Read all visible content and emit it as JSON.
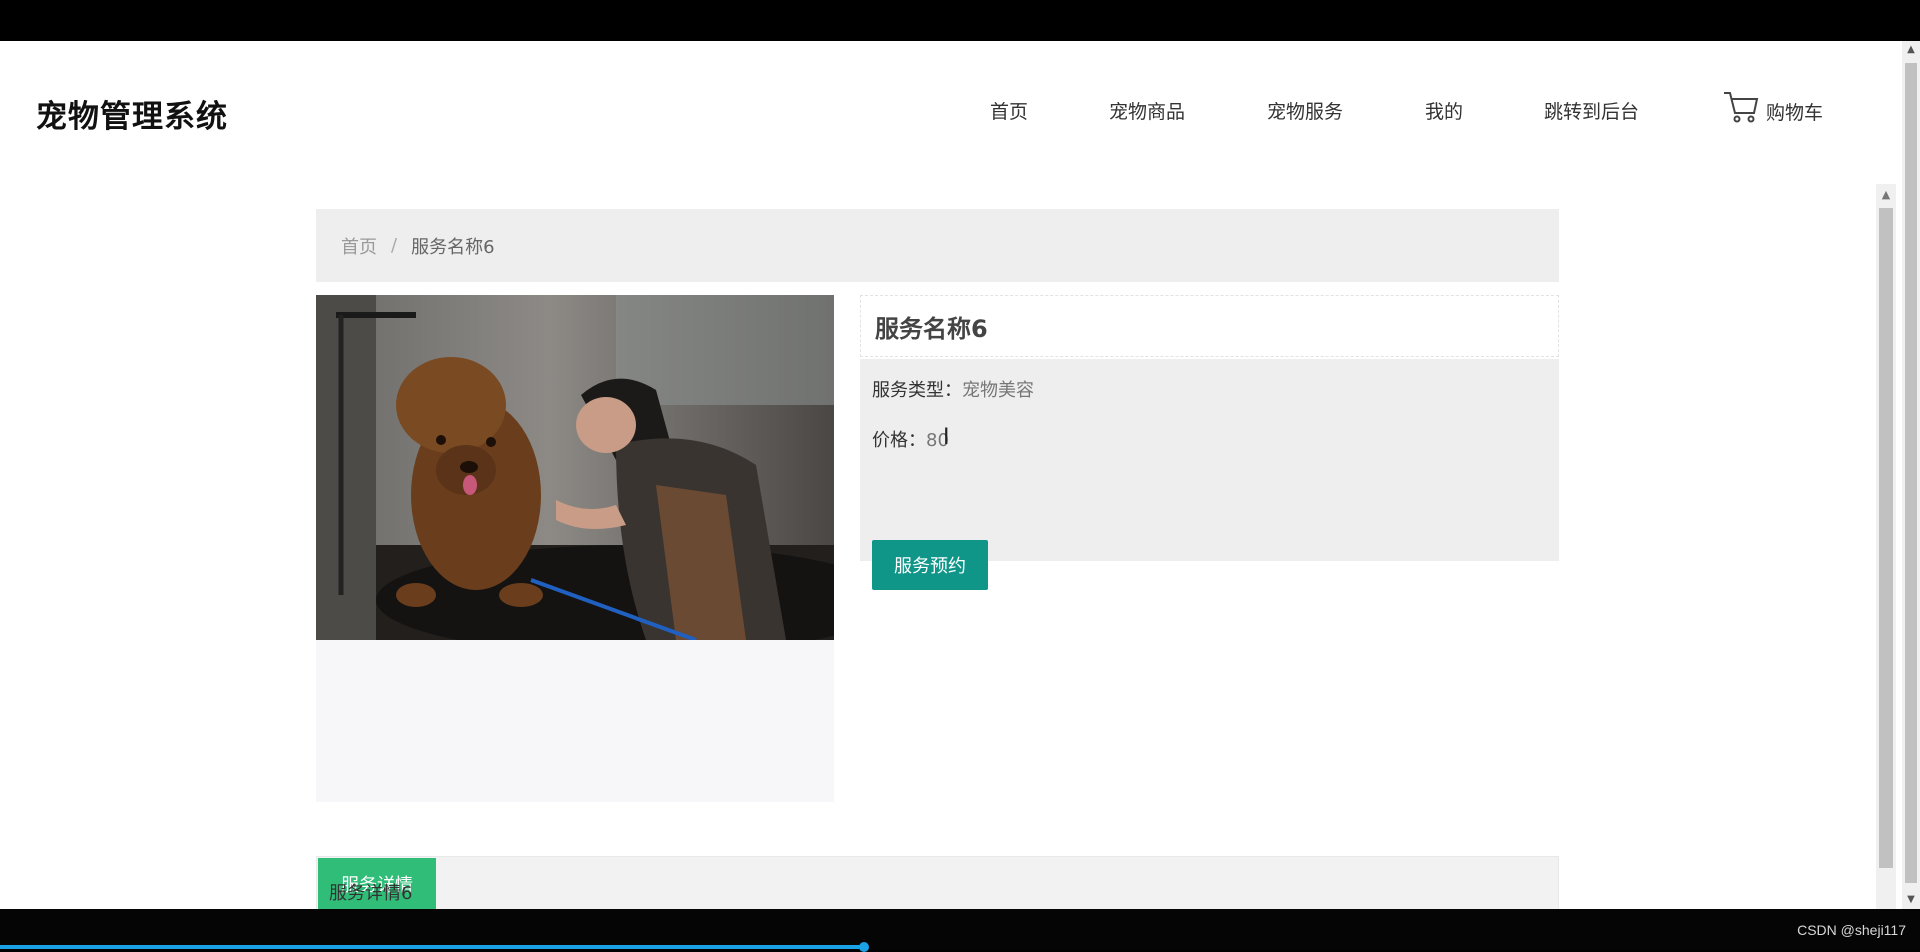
{
  "header": {
    "logo": "宠物管理系统",
    "nav": [
      "首页",
      "宠物商品",
      "宠物服务",
      "我的",
      "跳转到后台"
    ],
    "cart_label": "购物车"
  },
  "breadcrumb": {
    "home": "首页",
    "separator": "/",
    "current": "服务名称6"
  },
  "service": {
    "title": "服务名称6",
    "type_label": "服务类型：",
    "type_value": "宠物美容",
    "price_label": "价格：",
    "price_value": "80",
    "book_button": "服务预约"
  },
  "tabs": {
    "active": "服务详情",
    "content": "服务详情6"
  },
  "footer": {
    "watermark": "CSDN @sheji117"
  },
  "icons": {
    "cart": "cart-icon",
    "scroll_up": "scroll-up-arrow-icon",
    "scroll_down": "scroll-down-arrow-icon"
  },
  "colors": {
    "primary_button": "#109689",
    "active_tab": "#2fbd78",
    "video_progress": "#1aa1e6"
  },
  "video": {
    "progress": 0.45
  }
}
